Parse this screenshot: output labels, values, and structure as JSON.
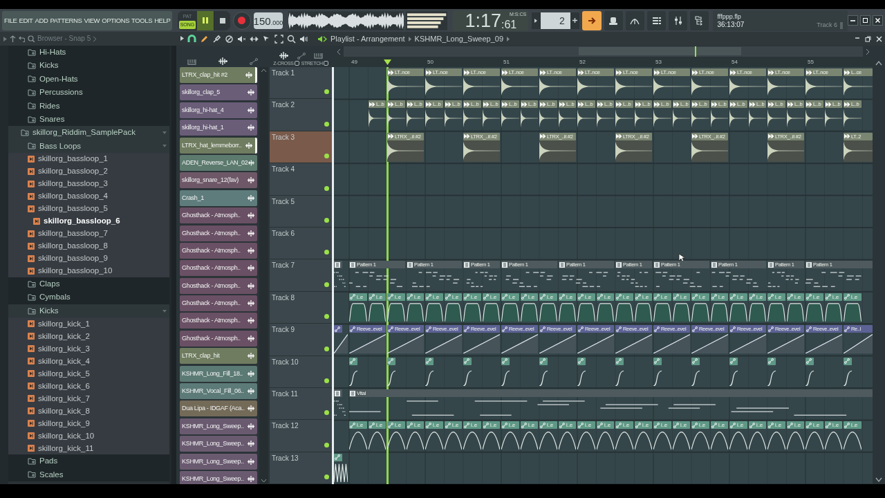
{
  "menu": [
    "FILE",
    "EDIT",
    "ADD",
    "PATTERNS",
    "VIEW",
    "OPTIONS",
    "TOOLS",
    "HELP"
  ],
  "mode_switch": [
    {
      "label": "PAT",
      "selected": false
    },
    {
      "label": "SONG",
      "selected": true
    }
  ],
  "transport": {
    "playing": true
  },
  "tempo": "150.000",
  "time": {
    "value": "1:17",
    "centiseconds": ":61",
    "format": "M:S:CS"
  },
  "pattern": "2",
  "hint_panel": {
    "file": "fffppp.flp",
    "elapsed": "36:13:07",
    "focus": "Track 6"
  },
  "browser": {
    "title": "Browser - Snap 5",
    "tree": [
      {
        "children": [
          {
            "kind": "folder",
            "label": "Hi-Hats",
            "expanded": false,
            "selected": false
          },
          {
            "kind": "folder",
            "label": "Kicks",
            "expanded": false,
            "selected": false
          },
          {
            "kind": "folder",
            "label": "Open-Hats",
            "expanded": false,
            "selected": false
          },
          {
            "kind": "folder",
            "label": "Percussions",
            "expanded": false,
            "selected": false
          },
          {
            "kind": "folder",
            "label": "Rides",
            "expanded": false,
            "selected": false
          },
          {
            "kind": "folder",
            "label": "Snares",
            "expanded": false,
            "selected": false
          }
        ]
      },
      {
        "kind": "folder",
        "label": "skillorg_Riddim_SamplePack",
        "expanded": true,
        "selected": false,
        "children": [
          {
            "kind": "folder",
            "label": "Bass Loops",
            "expanded": true,
            "selected": false,
            "children": [
              {
                "kind": "file",
                "label": "skillorg_bassloop_1",
                "selected": false
              },
              {
                "kind": "file",
                "label": "skillorg_bassloop_2",
                "selected": false
              },
              {
                "kind": "file",
                "label": "skillorg_bassloop_3",
                "selected": false
              },
              {
                "kind": "file",
                "label": "skillorg_bassloop_4",
                "selected": false
              },
              {
                "kind": "file",
                "label": "skillorg_bassloop_5",
                "selected": false
              },
              {
                "kind": "file",
                "label": "skillorg_bassloop_6",
                "selected": true
              },
              {
                "kind": "file",
                "label": "skillorg_bassloop_7",
                "selected": false
              },
              {
                "kind": "file",
                "label": "skillorg_bassloop_8",
                "selected": false
              },
              {
                "kind": "file",
                "label": "skillorg_bassloop_9",
                "selected": false
              },
              {
                "kind": "file",
                "label": "skillorg_bassloop_10",
                "selected": false
              }
            ]
          },
          {
            "kind": "folder",
            "label": "Claps",
            "expanded": false,
            "selected": false
          },
          {
            "kind": "folder",
            "label": "Cymbals",
            "expanded": false,
            "selected": false
          },
          {
            "kind": "folder",
            "label": "Kicks",
            "expanded": true,
            "selected": false,
            "children": [
              {
                "kind": "file",
                "label": "skillorg_kick_1",
                "selected": false
              },
              {
                "kind": "file",
                "label": "skillorg_kick_2",
                "selected": false
              },
              {
                "kind": "file",
                "label": "skillorg_kick_3",
                "selected": false
              },
              {
                "kind": "file",
                "label": "skillorg_kick_4",
                "selected": false
              },
              {
                "kind": "file",
                "label": "skillorg_kick_5",
                "selected": false
              },
              {
                "kind": "file",
                "label": "skillorg_kick_6",
                "selected": false
              },
              {
                "kind": "file",
                "label": "skillorg_kick_7",
                "selected": false
              },
              {
                "kind": "file",
                "label": "skillorg_kick_8",
                "selected": false
              },
              {
                "kind": "file",
                "label": "skillorg_kick_9",
                "selected": false
              },
              {
                "kind": "file",
                "label": "skillorg_kick_10",
                "selected": false
              },
              {
                "kind": "file",
                "label": "skillorg_kick_11",
                "selected": false
              }
            ]
          },
          {
            "kind": "folder",
            "label": "Pads",
            "expanded": false,
            "selected": false
          },
          {
            "kind": "folder",
            "label": "Scales",
            "expanded": false,
            "selected": false
          }
        ]
      }
    ]
  },
  "playlist": {
    "title": "Playlist - Arrangement",
    "clip_name": "KSHMR_Long_Sweep_09",
    "toggles": [
      {
        "label": "Z-CROSS",
        "checked": false
      },
      {
        "label": "STRETCH",
        "checked": false
      }
    ],
    "ruler": [
      "49",
      "50",
      "51",
      "52",
      "53",
      "54",
      "55"
    ],
    "channels": [
      {
        "label": "LTRX_clap_hit #2",
        "color": "#6f7c5f",
        "selected": true
      },
      {
        "label": "skillorg_clap_5",
        "color": "#6a5d78",
        "selected": false
      },
      {
        "label": "skillorg_hi-hat_4",
        "color": "#6a5d78",
        "selected": false
      },
      {
        "label": "skillorg_hi-hat_1",
        "color": "#6a5d78",
        "selected": false
      },
      {
        "label": "LTRX_hat_lemmeborr..",
        "color": "#6f7c5f",
        "selected": true
      },
      {
        "label": "ADEN_Reverse_LAN_02",
        "color": "#5c7a6e",
        "selected": false
      },
      {
        "label": "skillorg_snare_12(fav)",
        "color": "#6e5868",
        "selected": false
      },
      {
        "label": "Crash_1",
        "color": "#5f7c7c",
        "selected": false
      },
      {
        "label": "Ghosthack - Atmosph..",
        "color": "#6a5064",
        "selected": false
      },
      {
        "label": "Ghosthack - Atmosph..",
        "color": "#6a5064",
        "selected": false
      },
      {
        "label": "Ghosthack - Atmosph..",
        "color": "#6a5064",
        "selected": false
      },
      {
        "label": "Ghosthack - Atmosph..",
        "color": "#6a5064",
        "selected": false
      },
      {
        "label": "Ghosthack - Atmosph..",
        "color": "#6a5064",
        "selected": false
      },
      {
        "label": "Ghosthack - Atmosph..",
        "color": "#6a5064",
        "selected": false
      },
      {
        "label": "Ghosthack - Atmosph..",
        "color": "#6a5064",
        "selected": false
      },
      {
        "label": "Ghosthack - Atmosph..",
        "color": "#6a5064",
        "selected": false
      },
      {
        "label": "LTRX_clap_hit",
        "color": "#6f7c5f",
        "selected": false
      },
      {
        "label": "KSHMR_Long_Fill_18..",
        "color": "#5c7a74",
        "selected": false
      },
      {
        "label": "KSHMR_Vocal_Fill_06..",
        "color": "#5c7a78",
        "selected": false
      },
      {
        "label": "Dua Lipa - IDGAF (Aca..",
        "color": "#736a58",
        "selected": false
      },
      {
        "label": "KSHMR_Long_Sweep..",
        "color": "#6a5a70",
        "selected": false
      },
      {
        "label": "KSHMR_Long_Sweep..",
        "color": "#6a5a70",
        "selected": false
      },
      {
        "label": "KSHMR_Long_Sweep..",
        "color": "#6a5a70",
        "selected": false
      },
      {
        "label": "KSHMR_Long_Sweep..",
        "color": "#6a5a70",
        "selected": false
      }
    ],
    "tracks": [
      {
        "name": "Track 1",
        "selected": false,
        "enabled": true,
        "color": "#7b8672",
        "clips": [
          {
            "kind": "audio",
            "label": "LT..nce"
          },
          {
            "kind": "audio",
            "label": "LT..nce"
          },
          {
            "kind": "audio",
            "label": "LT..nce"
          },
          {
            "kind": "audio",
            "label": "LT..nce"
          },
          {
            "kind": "audio",
            "label": "LT..nce"
          },
          {
            "kind": "audio",
            "label": "LT..nce"
          },
          {
            "kind": "audio",
            "label": "LT..nce"
          },
          {
            "kind": "audio",
            "label": "LT..nce"
          },
          {
            "kind": "audio",
            "label": "LT..nce"
          },
          {
            "kind": "audio",
            "label": "LT..nce"
          },
          {
            "kind": "audio",
            "label": "LT..nce"
          },
          {
            "kind": "audio",
            "label": "LT..nce"
          },
          {
            "kind": "audio",
            "label": "L..ce"
          }
        ]
      },
      {
        "name": "Track 2",
        "selected": false,
        "enabled": true,
        "color": "#7b8672",
        "clips": [
          {
            "kind": "audio",
            "label": "L..b"
          },
          {
            "kind": "audio",
            "label": "L..b"
          },
          {
            "kind": "audio",
            "label": "L..b"
          },
          {
            "kind": "audio",
            "label": "L..b"
          },
          {
            "kind": "audio",
            "label": "L..b"
          },
          {
            "kind": "audio",
            "label": "L..b"
          },
          {
            "kind": "audio",
            "label": "L..b"
          },
          {
            "kind": "audio",
            "label": "L..b"
          },
          {
            "kind": "audio",
            "label": "L..b"
          },
          {
            "kind": "audio",
            "label": "L..b"
          },
          {
            "kind": "audio",
            "label": "L..b"
          },
          {
            "kind": "audio",
            "label": "L..b"
          },
          {
            "kind": "audio",
            "label": "L..b"
          },
          {
            "kind": "audio",
            "label": "L..b"
          },
          {
            "kind": "audio",
            "label": "L..b"
          },
          {
            "kind": "audio",
            "label": "L..b"
          },
          {
            "kind": "audio",
            "label": "L..b"
          },
          {
            "kind": "audio",
            "label": "L..b"
          },
          {
            "kind": "audio",
            "label": "L..b"
          },
          {
            "kind": "audio",
            "label": "L..b"
          },
          {
            "kind": "audio",
            "label": "L..b"
          },
          {
            "kind": "audio",
            "label": "L..b"
          },
          {
            "kind": "audio",
            "label": "L..b"
          },
          {
            "kind": "audio",
            "label": "L..b"
          },
          {
            "kind": "audio",
            "label": "L..b"
          },
          {
            "kind": "audio",
            "label": "L..b"
          }
        ]
      },
      {
        "name": "Track 3",
        "selected": true,
        "enabled": true,
        "color": "#7b8672",
        "clips": [
          {
            "kind": "audio",
            "label": "LTRX_..it #2"
          },
          {
            "kind": "audio",
            "label": "LTRX_..it #2"
          },
          {
            "kind": "audio",
            "label": "LTRX_..it #2"
          },
          {
            "kind": "audio",
            "label": "LTRX_..it #2"
          },
          {
            "kind": "audio",
            "label": "LTRX_..it #2"
          },
          {
            "kind": "audio",
            "label": "LTRX_..it #2"
          },
          {
            "kind": "audio",
            "label": "LT..2"
          }
        ]
      },
      {
        "name": "Track 4",
        "selected": false,
        "enabled": true
      },
      {
        "name": "Track 5",
        "selected": false,
        "enabled": true
      },
      {
        "name": "Track 6",
        "selected": false,
        "enabled": true
      },
      {
        "name": "Track 7",
        "selected": false,
        "enabled": true,
        "color": "#4f5a5e",
        "clips": [
          {
            "kind": "pattern"
          },
          {
            "kind": "pattern",
            "label": "Pattern 1"
          },
          {
            "kind": "pattern",
            "label": "Pattern 1"
          },
          {
            "kind": "pattern",
            "label": "Pattern 1"
          },
          {
            "kind": "pattern",
            "label": "Pattern 1"
          },
          {
            "kind": "pattern",
            "label": "Pattern 1"
          },
          {
            "kind": "pattern",
            "label": "Pattern 1"
          },
          {
            "kind": "pattern",
            "label": "Pattern 1"
          },
          {
            "kind": "pattern",
            "label": "Pattern 1"
          },
          {
            "kind": "pattern",
            "label": "Pattern 1"
          },
          {
            "kind": "pattern",
            "label": "Pattern 1"
          }
        ]
      },
      {
        "name": "Track 8",
        "selected": false,
        "enabled": true,
        "color": "#5f9886",
        "clips": [
          {
            "kind": "automation",
            "label": "l..e"
          },
          {
            "kind": "automation",
            "label": "l..e"
          },
          {
            "kind": "automation",
            "label": "l..e"
          },
          {
            "kind": "automation",
            "label": "l..e"
          },
          {
            "kind": "automation",
            "label": "l..e"
          },
          {
            "kind": "automation",
            "label": "l..e"
          },
          {
            "kind": "automation",
            "label": "l..e"
          },
          {
            "kind": "automation",
            "label": "l..e"
          },
          {
            "kind": "automation",
            "label": "l..e"
          },
          {
            "kind": "automation",
            "label": "l..e"
          },
          {
            "kind": "automation",
            "label": "l..e"
          },
          {
            "kind": "automation",
            "label": "l..e"
          },
          {
            "kind": "automation",
            "label": "l..e"
          },
          {
            "kind": "automation",
            "label": "l..e"
          },
          {
            "kind": "automation",
            "label": "l..e"
          },
          {
            "kind": "automation",
            "label": "l..e"
          },
          {
            "kind": "automation",
            "label": "l..e"
          },
          {
            "kind": "automation",
            "label": "l..e"
          },
          {
            "kind": "automation",
            "label": "l..e"
          },
          {
            "kind": "automation",
            "label": "l..e"
          },
          {
            "kind": "automation",
            "label": "l..e"
          },
          {
            "kind": "automation",
            "label": "l..e"
          },
          {
            "kind": "automation",
            "label": "l..e"
          },
          {
            "kind": "automation",
            "label": "l..e"
          },
          {
            "kind": "automation",
            "label": "l..e"
          },
          {
            "kind": "automation",
            "label": "l..e"
          },
          {
            "kind": "automation",
            "label": "l..e"
          }
        ]
      },
      {
        "name": "Track 9",
        "selected": false,
        "enabled": true,
        "color": "#5c6294",
        "clips": [
          {
            "kind": "automation"
          },
          {
            "kind": "automation",
            "label": "Reeve..evel"
          },
          {
            "kind": "automation",
            "label": "Reeve..evel"
          },
          {
            "kind": "automation",
            "label": "Reeve..evel"
          },
          {
            "kind": "automation",
            "label": "Reeve..evel"
          },
          {
            "kind": "automation",
            "label": "Reeve..evel"
          },
          {
            "kind": "automation",
            "label": "Reeve..evel"
          },
          {
            "kind": "automation",
            "label": "Reeve..evel"
          },
          {
            "kind": "automation",
            "label": "Reeve..evel"
          },
          {
            "kind": "automation",
            "label": "Reeve..evel"
          },
          {
            "kind": "automation",
            "label": "Reeve..evel"
          },
          {
            "kind": "automation",
            "label": "Reeve..evel"
          },
          {
            "kind": "automation",
            "label": "Reeve..evel"
          },
          {
            "kind": "automation",
            "label": "Reeve..evel"
          },
          {
            "kind": "automation",
            "label": "Re..l"
          }
        ]
      },
      {
        "name": "Track 10",
        "selected": false,
        "enabled": true,
        "color": "#5f9886",
        "clips": [
          {
            "kind": "automation"
          },
          {
            "kind": "automation"
          },
          {
            "kind": "automation"
          },
          {
            "kind": "automation"
          },
          {
            "kind": "automation"
          },
          {
            "kind": "automation"
          },
          {
            "kind": "automation"
          },
          {
            "kind": "automation"
          },
          {
            "kind": "automation"
          },
          {
            "kind": "automation"
          },
          {
            "kind": "automation"
          },
          {
            "kind": "automation"
          },
          {
            "kind": "automation"
          },
          {
            "kind": "automation"
          }
        ]
      },
      {
        "name": "Track 11",
        "selected": false,
        "enabled": true,
        "color": "#4f5a5e",
        "clips": [
          {
            "kind": "pattern"
          },
          {
            "kind": "pattern",
            "label": "Vital"
          }
        ]
      },
      {
        "name": "Track 12",
        "selected": false,
        "enabled": true,
        "color": "#5f9886",
        "clips": [
          {
            "kind": "automation",
            "label": "l..e"
          },
          {
            "kind": "automation",
            "label": "l..e"
          },
          {
            "kind": "automation",
            "label": "l..e"
          },
          {
            "kind": "automation",
            "label": "l..e"
          },
          {
            "kind": "automation",
            "label": "l..e"
          },
          {
            "kind": "automation",
            "label": "l..e"
          },
          {
            "kind": "automation",
            "label": "l..e"
          },
          {
            "kind": "automation",
            "label": "l..e"
          },
          {
            "kind": "automation",
            "label": "l..e"
          },
          {
            "kind": "automation",
            "label": "l..e"
          },
          {
            "kind": "automation",
            "label": "l..e"
          },
          {
            "kind": "automation",
            "label": "l..e"
          },
          {
            "kind": "automation",
            "label": "l..e"
          },
          {
            "kind": "automation",
            "label": "l..e"
          },
          {
            "kind": "automation",
            "label": "l..e"
          },
          {
            "kind": "automation",
            "label": "l..e"
          },
          {
            "kind": "automation",
            "label": "l..e"
          },
          {
            "kind": "automation",
            "label": "l..e"
          },
          {
            "kind": "automation",
            "label": "l..e"
          },
          {
            "kind": "automation",
            "label": "l..e"
          },
          {
            "kind": "automation",
            "label": "l..e"
          },
          {
            "kind": "automation",
            "label": "l..e"
          },
          {
            "kind": "automation",
            "label": "l..e"
          },
          {
            "kind": "automation",
            "label": "l..e"
          },
          {
            "kind": "automation",
            "label": "l..e"
          },
          {
            "kind": "automation",
            "label": "l..e"
          },
          {
            "kind": "automation",
            "label": "l..e"
          }
        ]
      },
      {
        "name": "Track 13",
        "selected": false,
        "enabled": true,
        "color": "#5f9886",
        "clips": [
          {
            "kind": "automation"
          }
        ]
      }
    ]
  }
}
